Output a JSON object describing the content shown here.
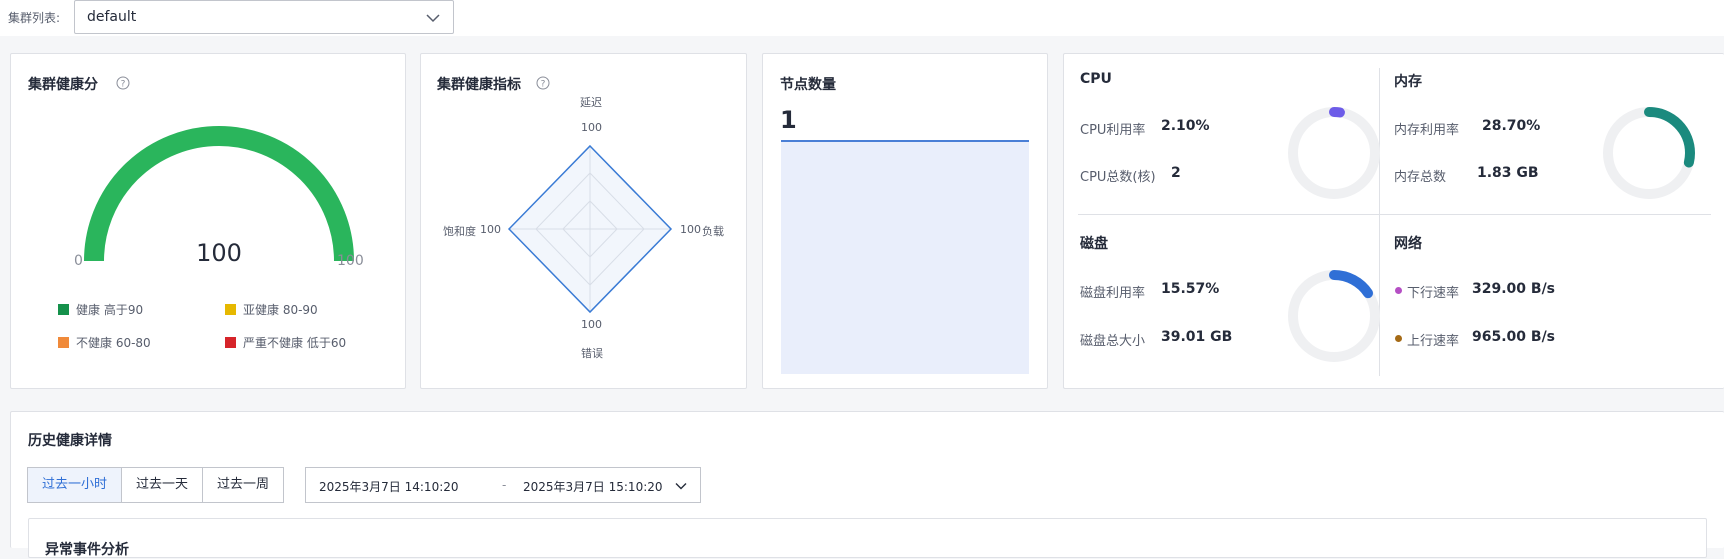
{
  "filter": {
    "label": "集群列表:",
    "value": "default"
  },
  "health_score": {
    "title": "集群健康分",
    "value": "100",
    "min": "0",
    "max": "100",
    "score": 100,
    "legend": [
      {
        "color": "#15914b",
        "text": "健康 高于90"
      },
      {
        "color": "#e6b800",
        "text": "亚健康 80-90"
      },
      {
        "color": "#f08a3a",
        "text": "不健康 60-80"
      },
      {
        "color": "#d6242a",
        "text": "严重不健康 低于60"
      }
    ]
  },
  "health_metrics": {
    "title": "集群健康指标",
    "axes": [
      {
        "name": "延迟",
        "value": "100"
      },
      {
        "name": "负载",
        "value": "100"
      },
      {
        "name": "错误",
        "value": "100"
      },
      {
        "name": "饱和度",
        "value": "100"
      }
    ]
  },
  "node_count": {
    "title": "节点数量",
    "value": "1"
  },
  "cpu": {
    "title": "CPU",
    "usage_label": "CPU利用率",
    "usage_value": "2.10%",
    "usage": 0.021,
    "cores_label": "CPU总数(核)",
    "cores_value": "2"
  },
  "memory": {
    "title": "内存",
    "usage_label": "内存利用率",
    "usage_value": "28.70%",
    "usage": 0.287,
    "total_label": "内存总数",
    "total_value": "1.83 GB"
  },
  "disk": {
    "title": "磁盘",
    "usage_label": "磁盘利用率",
    "usage_value": "15.57%",
    "usage": 0.1557,
    "total_label": "磁盘总大小",
    "total_value": "39.01 GB"
  },
  "network": {
    "title": "网络",
    "down_label": "下行速率",
    "down_value": "329.00 B/s",
    "up_label": "上行速率",
    "up_value": "965.00 B/s"
  },
  "history": {
    "title": "历史健康详情",
    "tabs": [
      "过去一小时",
      "过去一天",
      "过去一周"
    ],
    "start": "2025年3月7日 14:10:20",
    "separator": "-",
    "end": "2025年3月7日 15:10:20",
    "section_title": "异常事件分析"
  },
  "colors": {
    "gauge_green": "#2ab55c",
    "cpu_ring": "#6d5ce8",
    "mem_ring": "#1b8a7e",
    "disk_ring": "#2f6fd6",
    "down_dot": "#b54fc4",
    "up_dot": "#a56a16"
  }
}
